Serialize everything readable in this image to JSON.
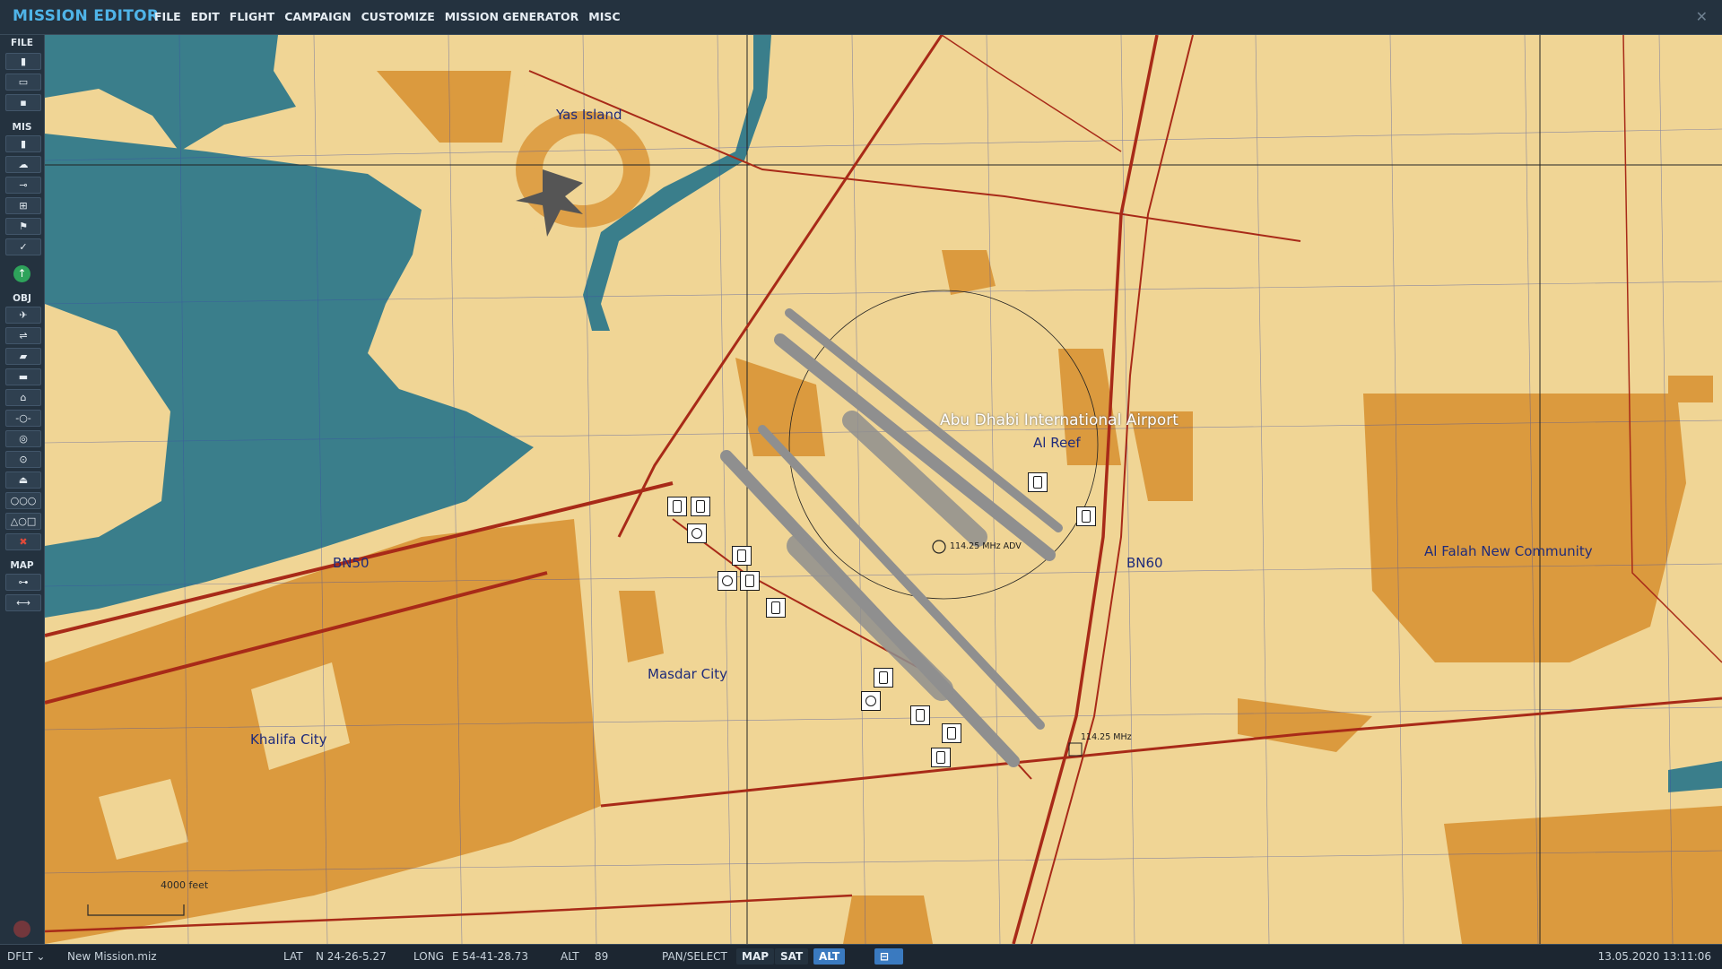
{
  "app": {
    "title": "MISSION EDITOR",
    "close_icon": "close-icon"
  },
  "menu": [
    "FILE",
    "EDIT",
    "FLIGHT",
    "CAMPAIGN",
    "CUSTOMIZE",
    "MISSION GENERATOR",
    "MISC"
  ],
  "sidebar": {
    "sections": {
      "file": "FILE",
      "mis": "MIS",
      "obj": "OBJ",
      "map": "MAP"
    },
    "file_tools": [
      "new-file-icon",
      "open-file-icon",
      "save-file-icon"
    ],
    "mis_tools": [
      "briefing-icon",
      "weather-icon",
      "trigger-zone-icon",
      "target-icon",
      "flag-icon",
      "check-icon"
    ],
    "obj_tools": [
      "airplane-icon",
      "helicopter-icon",
      "ship-icon",
      "vehicle-icon",
      "static-object-icon",
      "waypoint-icon",
      "zone-icon",
      "target-circle-icon",
      "naval-icon",
      "template-icon",
      "shapes-icon",
      "delete-icon"
    ],
    "map_tools": [
      "ruler-icon",
      "measure-icon"
    ],
    "go_icon": "up-arrow-icon",
    "exit_icon": "exit-icon"
  },
  "map": {
    "labels": {
      "yas_island": "Yas Island",
      "airport": "Abu Dhabi International Airport",
      "al_reef": "Al Reef",
      "al_falah": "Al Falah New Community",
      "bn50": "BN50",
      "bn60": "BN60",
      "masdar": "Masdar City",
      "khalifa": "Khalifa City"
    },
    "freq_adv": "114.25 MHz ADV",
    "freq_2": "114.25 MHz",
    "scale": "4000 feet",
    "colors": {
      "land": "#f0d595",
      "urban": "#db9a3e",
      "water": "#3a7e8b",
      "road": "#a82a18",
      "runway": "#8f8f8f",
      "grid": "#3a4aa6"
    }
  },
  "status": {
    "profile": "DFLT",
    "file": "New Mission.miz",
    "lat_label": "LAT",
    "lat": "N 24-26-5.27",
    "long_label": "LONG",
    "long": "E 54-41-28.73",
    "alt_label": "ALT",
    "alt": "89",
    "mode": "PAN/SELECT",
    "buttons": [
      "MAP",
      "SAT",
      "ALT"
    ],
    "active": "ALT",
    "datetime": "13.05.2020 13:11:06"
  }
}
